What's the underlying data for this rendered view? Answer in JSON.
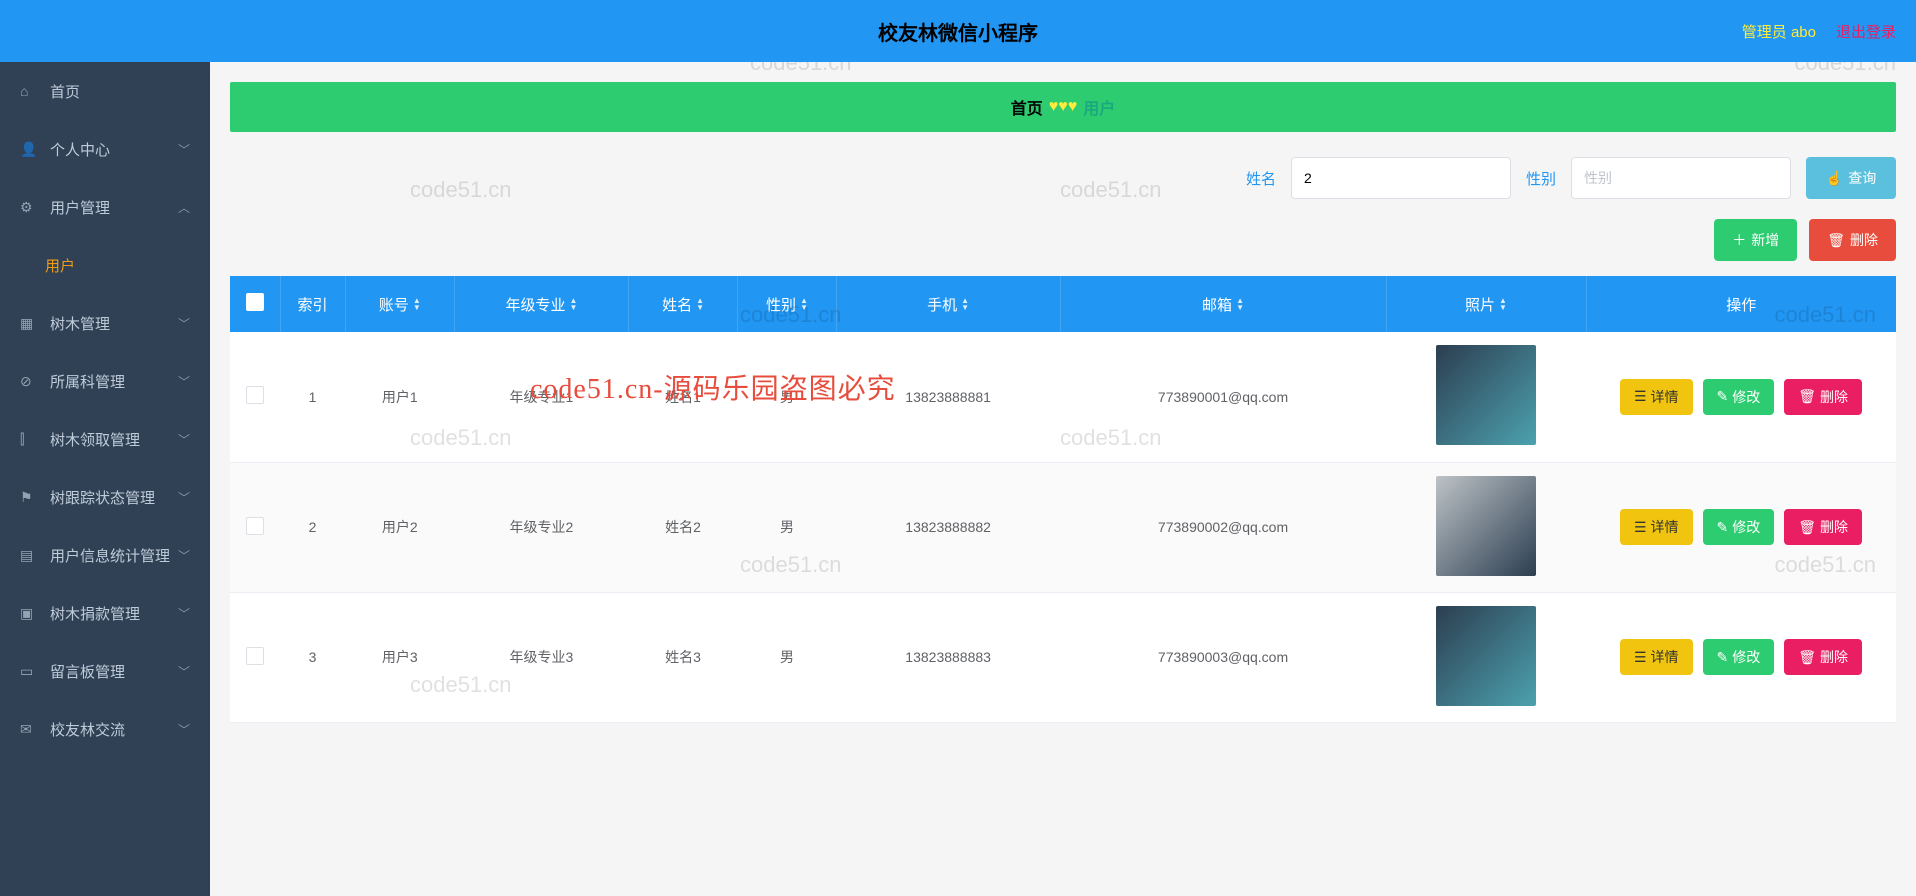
{
  "header": {
    "title": "校友林微信小程序",
    "admin_label": "管理员 abo",
    "logout_label": "退出登录"
  },
  "sidebar": {
    "items": [
      {
        "icon": "home-icon",
        "glyph": "⌂",
        "label": "首页",
        "expandable": false
      },
      {
        "icon": "user-icon",
        "glyph": "👤",
        "label": "个人中心",
        "expandable": true,
        "open": false
      },
      {
        "icon": "gear-icon",
        "glyph": "⚙",
        "label": "用户管理",
        "expandable": true,
        "open": true,
        "children": [
          {
            "label": "用户"
          }
        ]
      },
      {
        "icon": "tree-icon",
        "glyph": "▦",
        "label": "树木管理",
        "expandable": true,
        "open": false
      },
      {
        "icon": "category-icon",
        "glyph": "⊘",
        "label": "所属科管理",
        "expandable": true,
        "open": false
      },
      {
        "icon": "chart-icon",
        "glyph": "⫿⫿",
        "label": "树木领取管理",
        "expandable": true,
        "open": false
      },
      {
        "icon": "flag-icon",
        "glyph": "⚑",
        "label": "树跟踪状态管理",
        "expandable": true,
        "open": false
      },
      {
        "icon": "stats-icon",
        "glyph": "▤",
        "label": "用户信息统计管理",
        "expandable": true,
        "open": false
      },
      {
        "icon": "donate-icon",
        "glyph": "▣",
        "label": "树木捐款管理",
        "expandable": true,
        "open": false
      },
      {
        "icon": "message-icon",
        "glyph": "▭",
        "label": "留言板管理",
        "expandable": true,
        "open": false
      },
      {
        "icon": "mail-icon",
        "glyph": "✉",
        "label": "校友林交流",
        "expandable": true,
        "open": false
      }
    ]
  },
  "breadcrumb": {
    "home": "首页",
    "hearts": "♥♥♥",
    "current": "用户"
  },
  "search": {
    "name_label": "姓名",
    "name_value": "2",
    "gender_label": "性别",
    "gender_placeholder": "性别",
    "query_button": "查询"
  },
  "toolbar": {
    "add_label": "新增",
    "delete_label": "删除"
  },
  "table": {
    "headers": {
      "index": "索引",
      "account": "账号",
      "grade": "年级专业",
      "name": "姓名",
      "gender": "性别",
      "phone": "手机",
      "email": "邮箱",
      "photo": "照片",
      "op": "操作"
    },
    "rows": [
      {
        "index": "1",
        "account": "用户1",
        "grade": "年级专业1",
        "name": "姓名1",
        "gender": "男",
        "phone": "13823888881",
        "email": "773890001@qq.com"
      },
      {
        "index": "2",
        "account": "用户2",
        "grade": "年级专业2",
        "name": "姓名2",
        "gender": "男",
        "phone": "13823888882",
        "email": "773890002@qq.com"
      },
      {
        "index": "3",
        "account": "用户3",
        "grade": "年级专业3",
        "name": "姓名3",
        "gender": "男",
        "phone": "13823888883",
        "email": "773890003@qq.com"
      }
    ],
    "row_actions": {
      "detail": "详情",
      "edit": "修改",
      "delete": "删除"
    }
  },
  "watermarks": {
    "text": "code51.cn",
    "red_text": "code51.cn-源码乐园盗图必究"
  }
}
